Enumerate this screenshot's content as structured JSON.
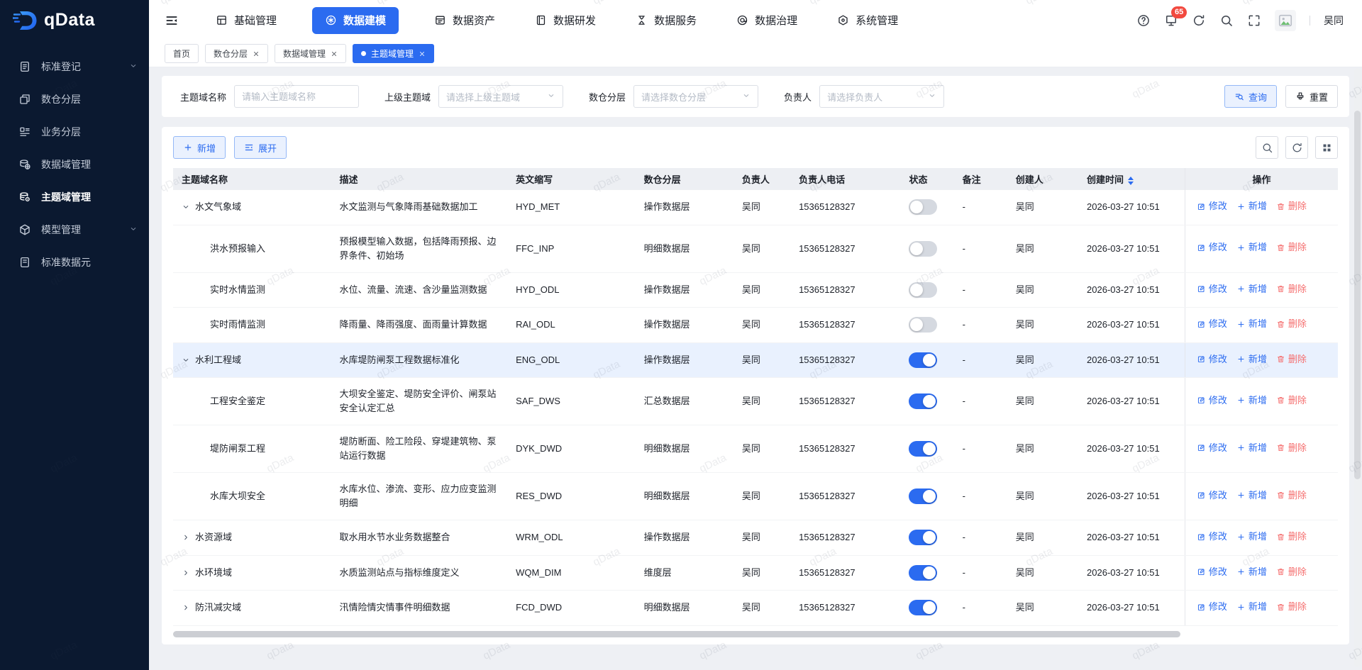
{
  "brand": {
    "name": "qData"
  },
  "topbar": {
    "nav": [
      {
        "id": "basic-mgmt",
        "label": "基础管理",
        "icon": "grid-icon",
        "active": false
      },
      {
        "id": "data-modeling",
        "label": "数据建模",
        "icon": "modeling-icon",
        "active": true
      },
      {
        "id": "data-asset",
        "label": "数据资产",
        "icon": "asset-icon",
        "active": false
      },
      {
        "id": "data-dev",
        "label": "数据研发",
        "icon": "notebook-icon",
        "active": false
      },
      {
        "id": "data-service",
        "label": "数据服务",
        "icon": "hourglass-icon",
        "active": false
      },
      {
        "id": "data-governance",
        "label": "数据治理",
        "icon": "governance-icon",
        "active": false
      },
      {
        "id": "system-mgmt",
        "label": "系统管理",
        "icon": "system-icon",
        "active": false
      }
    ],
    "notification_count": "65",
    "username": "吴同"
  },
  "tabs": [
    {
      "id": "home",
      "label": "首页",
      "closable": false,
      "active": false
    },
    {
      "id": "dw-layers",
      "label": "数仓分层",
      "closable": true,
      "active": false
    },
    {
      "id": "data-domain-mgmt",
      "label": "数据域管理",
      "closable": true,
      "active": false
    },
    {
      "id": "subject-domain-mgmt",
      "label": "主题域管理",
      "closable": true,
      "active": true
    }
  ],
  "sidebar": {
    "items": [
      {
        "id": "standard-registry",
        "label": "标准登记",
        "icon": "doc-icon",
        "chevron": true,
        "active": false
      },
      {
        "id": "dw-layers",
        "label": "数仓分层",
        "icon": "layers-icon",
        "chevron": false,
        "active": false
      },
      {
        "id": "business-layers",
        "label": "业务分层",
        "icon": "layout-icon",
        "chevron": false,
        "active": false
      },
      {
        "id": "data-domain-mgmt",
        "label": "数据域管理",
        "icon": "database-globe-icon",
        "chevron": false,
        "active": false
      },
      {
        "id": "subject-domain-mgmt",
        "label": "主题域管理",
        "icon": "database-gear-icon",
        "chevron": false,
        "active": true
      },
      {
        "id": "model-mgmt",
        "label": "模型管理",
        "icon": "cube-icon",
        "chevron": true,
        "active": false
      },
      {
        "id": "standard-data-element",
        "label": "标准数据元",
        "icon": "tablet-icon",
        "chevron": false,
        "active": false
      }
    ]
  },
  "filters": {
    "fields": [
      {
        "id": "name",
        "label": "主题域名称",
        "placeholder": "请输入主题域名称",
        "type": "input"
      },
      {
        "id": "parent",
        "label": "上级主题域",
        "placeholder": "请选择上级主题域",
        "type": "select"
      },
      {
        "id": "layer",
        "label": "数仓分层",
        "placeholder": "请选择数仓分层",
        "type": "select"
      },
      {
        "id": "owner",
        "label": "负责人",
        "placeholder": "请选择负责人",
        "type": "select"
      }
    ],
    "query_label": "查询",
    "reset_label": "重置"
  },
  "toolbar": {
    "add_label": "新增",
    "expand_label": "展开"
  },
  "table": {
    "columns": [
      "主题域名称",
      "描述",
      "英文缩写",
      "数仓分层",
      "负责人",
      "负责人电话",
      "状态",
      "备注",
      "创建人",
      "创建时间",
      "操作"
    ],
    "sort_column": "创建时间",
    "actions": [
      {
        "id": "edit",
        "label": "修改",
        "icon": "edit-icon"
      },
      {
        "id": "add",
        "label": "新增",
        "icon": "plus-icon"
      },
      {
        "id": "delete",
        "label": "删除",
        "icon": "trash-icon"
      }
    ],
    "rows": [
      {
        "name": "水文气象域",
        "expand": "expanded",
        "child": false,
        "desc": "水文监测与气象降雨基础数据加工",
        "abbr": "HYD_MET",
        "layer": "操作数据层",
        "owner": "吴同",
        "phone": "15365128327",
        "status": false,
        "remark": "-",
        "creator": "吴同",
        "created": "2026-03-27 10:51",
        "highlight": false
      },
      {
        "name": "洪水预报输入",
        "expand": "none",
        "child": true,
        "desc": "预报模型输入数据，包括降雨预报、边界条件、初始场",
        "abbr": "FFC_INP",
        "layer": "明细数据层",
        "owner": "吴同",
        "phone": "15365128327",
        "status": false,
        "remark": "-",
        "creator": "吴同",
        "created": "2026-03-27 10:51",
        "highlight": false
      },
      {
        "name": "实时水情监测",
        "expand": "none",
        "child": true,
        "desc": "水位、流量、流速、含沙量监测数据",
        "abbr": "HYD_ODL",
        "layer": "操作数据层",
        "owner": "吴同",
        "phone": "15365128327",
        "status": false,
        "remark": "-",
        "creator": "吴同",
        "created": "2026-03-27 10:51",
        "highlight": false
      },
      {
        "name": "实时雨情监测",
        "expand": "none",
        "child": true,
        "desc": "降雨量、降雨强度、面雨量计算数据",
        "abbr": "RAI_ODL",
        "layer": "操作数据层",
        "owner": "吴同",
        "phone": "15365128327",
        "status": false,
        "remark": "-",
        "creator": "吴同",
        "created": "2026-03-27 10:51",
        "highlight": false
      },
      {
        "name": "水利工程域",
        "expand": "expanded",
        "child": false,
        "desc": "水库堤防闸泵工程数据标准化",
        "abbr": "ENG_ODL",
        "layer": "操作数据层",
        "owner": "吴同",
        "phone": "15365128327",
        "status": true,
        "remark": "-",
        "creator": "吴同",
        "created": "2026-03-27 10:51",
        "highlight": true
      },
      {
        "name": "工程安全鉴定",
        "expand": "none",
        "child": true,
        "desc": "大坝安全鉴定、堤防安全评价、闸泵站安全认定汇总",
        "abbr": "SAF_DWS",
        "layer": "汇总数据层",
        "owner": "吴同",
        "phone": "15365128327",
        "status": true,
        "remark": "-",
        "creator": "吴同",
        "created": "2026-03-27 10:51",
        "highlight": false
      },
      {
        "name": "堤防闸泵工程",
        "expand": "none",
        "child": true,
        "desc": "堤防断面、险工险段、穿堤建筑物、泵站运行数据",
        "abbr": "DYK_DWD",
        "layer": "明细数据层",
        "owner": "吴同",
        "phone": "15365128327",
        "status": true,
        "remark": "-",
        "creator": "吴同",
        "created": "2026-03-27 10:51",
        "highlight": false
      },
      {
        "name": "水库大坝安全",
        "expand": "none",
        "child": true,
        "desc": "水库水位、渗流、变形、应力应变监测明细",
        "abbr": "RES_DWD",
        "layer": "明细数据层",
        "owner": "吴同",
        "phone": "15365128327",
        "status": true,
        "remark": "-",
        "creator": "吴同",
        "created": "2026-03-27 10:51",
        "highlight": false
      },
      {
        "name": "水资源域",
        "expand": "collapsed",
        "child": false,
        "desc": "取水用水节水业务数据整合",
        "abbr": "WRM_ODL",
        "layer": "操作数据层",
        "owner": "吴同",
        "phone": "15365128327",
        "status": true,
        "remark": "-",
        "creator": "吴同",
        "created": "2026-03-27 10:51",
        "highlight": false
      },
      {
        "name": "水环境域",
        "expand": "collapsed",
        "child": false,
        "desc": "水质监测站点与指标维度定义",
        "abbr": "WQM_DIM",
        "layer": "维度层",
        "owner": "吴同",
        "phone": "15365128327",
        "status": true,
        "remark": "-",
        "creator": "吴同",
        "created": "2026-03-27 10:51",
        "highlight": false
      },
      {
        "name": "防汛减灾域",
        "expand": "collapsed",
        "child": false,
        "desc": "汛情险情灾情事件明细数据",
        "abbr": "FCD_DWD",
        "layer": "明细数据层",
        "owner": "吴同",
        "phone": "15365128327",
        "status": true,
        "remark": "-",
        "creator": "吴同",
        "created": "2026-03-27 10:51",
        "highlight": false
      }
    ]
  },
  "watermark_text": "qData",
  "colors": {
    "accent": "#2b6bf0",
    "danger": "#f56e6e",
    "sidebar_bg": "#0b1930",
    "badge": "#f2493f"
  }
}
